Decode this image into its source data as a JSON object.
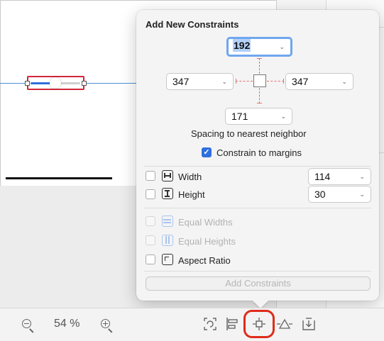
{
  "popover": {
    "title": "Add New Constraints",
    "top_value": "192",
    "left_value": "347",
    "right_value": "347",
    "bottom_value": "171",
    "spacing_label": "Spacing to nearest neighbor",
    "constrain_margins_label": "Constrain to margins",
    "constrain_margins_checked": true,
    "width_label": "Width",
    "width_value": "114",
    "height_label": "Height",
    "height_value": "30",
    "equal_widths_label": "Equal Widths",
    "equal_heights_label": "Equal Heights",
    "aspect_ratio_label": "Aspect Ratio",
    "add_button_label": "Add Constraints"
  },
  "toolbar": {
    "zoom_value": "54 %"
  },
  "icons": {
    "zoom_out": "zoom-out-icon",
    "zoom_in": "zoom-in-icon",
    "update_frames": "update-frames-icon",
    "align": "align-icon",
    "add_constraints": "add-constraints-icon",
    "resolve_issues": "resolve-auto-layout-issues-icon",
    "embed_in": "embed-in-icon"
  },
  "colors": {
    "accent": "#2f6fdf",
    "highlight_ring": "#e02b1b",
    "constraint_dash": "#e07070"
  }
}
